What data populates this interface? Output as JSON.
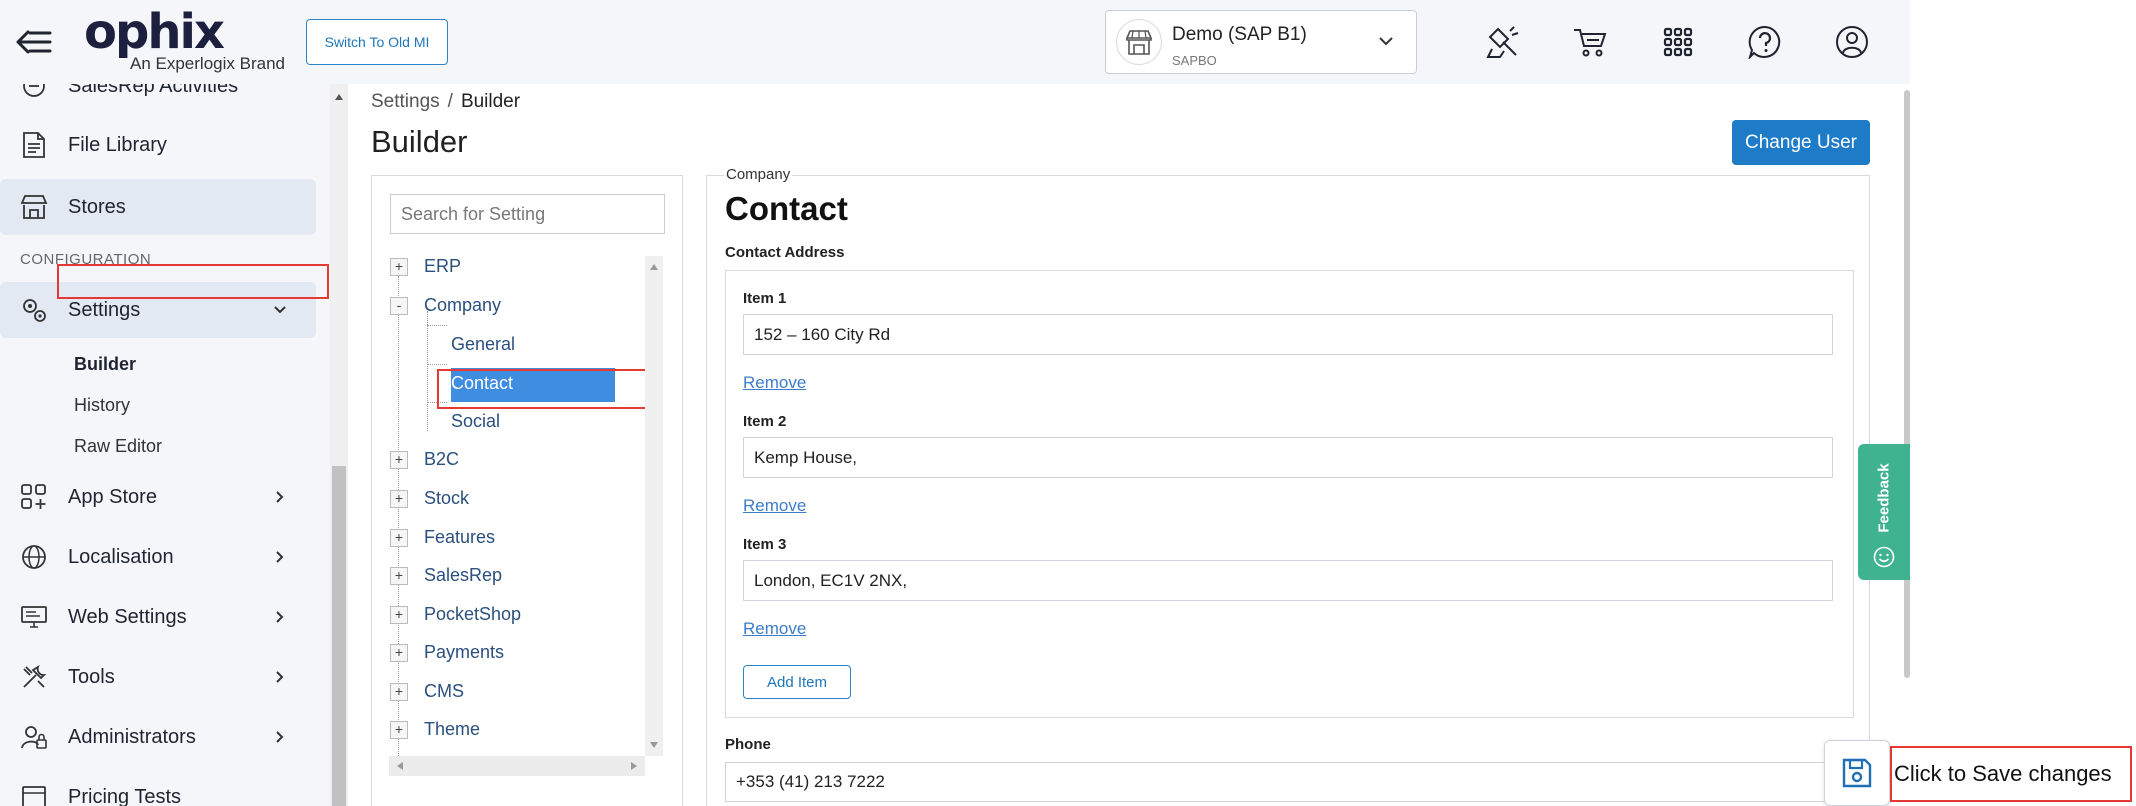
{
  "header": {
    "logo_text": "ophix",
    "logo_sub": "An Experlogix Brand",
    "switch_button": "Switch To Old MI",
    "store": {
      "name": "Demo (SAP B1)",
      "sub": "SAPBO"
    },
    "icons": [
      "clean-icon",
      "cart-icon",
      "apps-grid-icon",
      "help-icon",
      "user-icon"
    ]
  },
  "sidebar": {
    "items_top": [
      {
        "label": "SalesRep Activities",
        "icon": "activities-icon"
      },
      {
        "label": "File Library",
        "icon": "file-library-icon"
      },
      {
        "label": "Stores",
        "icon": "store-icon"
      }
    ],
    "section_label": "CONFIGURATION",
    "settings": {
      "label": "Settings"
    },
    "settings_subitems": [
      {
        "label": "Builder"
      },
      {
        "label": "History"
      },
      {
        "label": "Raw Editor"
      }
    ],
    "items_bottom": [
      {
        "label": "App Store"
      },
      {
        "label": "Localisation"
      },
      {
        "label": "Web Settings"
      },
      {
        "label": "Tools"
      },
      {
        "label": "Administrators"
      },
      {
        "label": "Pricing Tests"
      }
    ]
  },
  "breadcrumb": {
    "root": "Settings",
    "separator": "/",
    "current": "Builder"
  },
  "page": {
    "title": "Builder",
    "change_user": "Change User"
  },
  "tree": {
    "search_placeholder": "Search for Setting",
    "nodes": [
      {
        "label": "ERP",
        "toggle": "+"
      },
      {
        "label": "Company",
        "toggle": "-"
      },
      {
        "label": "General"
      },
      {
        "label": "Contact"
      },
      {
        "label": "Social"
      },
      {
        "label": "B2C",
        "toggle": "+"
      },
      {
        "label": "Stock",
        "toggle": "+"
      },
      {
        "label": "Features",
        "toggle": "+"
      },
      {
        "label": "SalesRep",
        "toggle": "+"
      },
      {
        "label": "PocketShop",
        "toggle": "+"
      },
      {
        "label": "Payments",
        "toggle": "+"
      },
      {
        "label": "CMS",
        "toggle": "+"
      },
      {
        "label": "Theme",
        "toggle": "+"
      }
    ]
  },
  "form": {
    "caption": "Company",
    "title": "Contact",
    "section": "Contact Address",
    "items": [
      {
        "label": "Item 1",
        "value": "152 – 160 City Rd",
        "remove": "Remove"
      },
      {
        "label": "Item 2",
        "value": "Kemp House,",
        "remove": "Remove"
      },
      {
        "label": "Item 3",
        "value": "London, EC1V 2NX,",
        "remove": "Remove"
      }
    ],
    "add_item": "Add Item",
    "phone": {
      "label": "Phone",
      "value": "+353 (41) 213 7222"
    }
  },
  "feedback": "Feedback",
  "save_tip": "Click to Save changes",
  "colors": {
    "accent": "#1e7bc8",
    "feedback": "#3fb28f",
    "highlight": "#e53935",
    "tree_selected": "#3e8de1"
  }
}
